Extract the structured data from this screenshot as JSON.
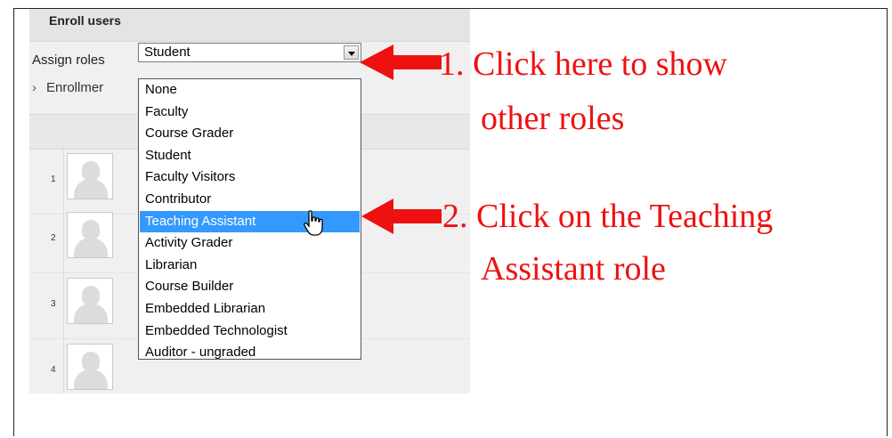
{
  "window": {
    "title": "Enroll users"
  },
  "assign_roles": {
    "label": "Assign roles",
    "selected": "Student",
    "options": [
      "None",
      "Faculty",
      "Course Grader",
      "Student",
      "Faculty Visitors",
      "Contributor",
      "Teaching Assistant",
      "Activity Grader",
      "Librarian",
      "Course Builder",
      "Embedded Librarian",
      "Embedded Technologist",
      "Auditor - ungraded"
    ],
    "highlighted": "Teaching Assistant"
  },
  "enrollment_options": {
    "label": "Enrollmer",
    "icon": "chevron-right-icon"
  },
  "users": [
    {
      "number": "1"
    },
    {
      "number": "2"
    },
    {
      "number": "3"
    },
    {
      "number": "4"
    }
  ],
  "annotations": {
    "step1_line1": "1. Click here to show",
    "step1_line2": "other roles",
    "step2_line1": "2. Click on the Teaching",
    "step2_line2": "Assistant role",
    "arrow_color": "#ee1111"
  },
  "colors": {
    "highlight": "#3399ff",
    "annotation": "#ee1111"
  }
}
